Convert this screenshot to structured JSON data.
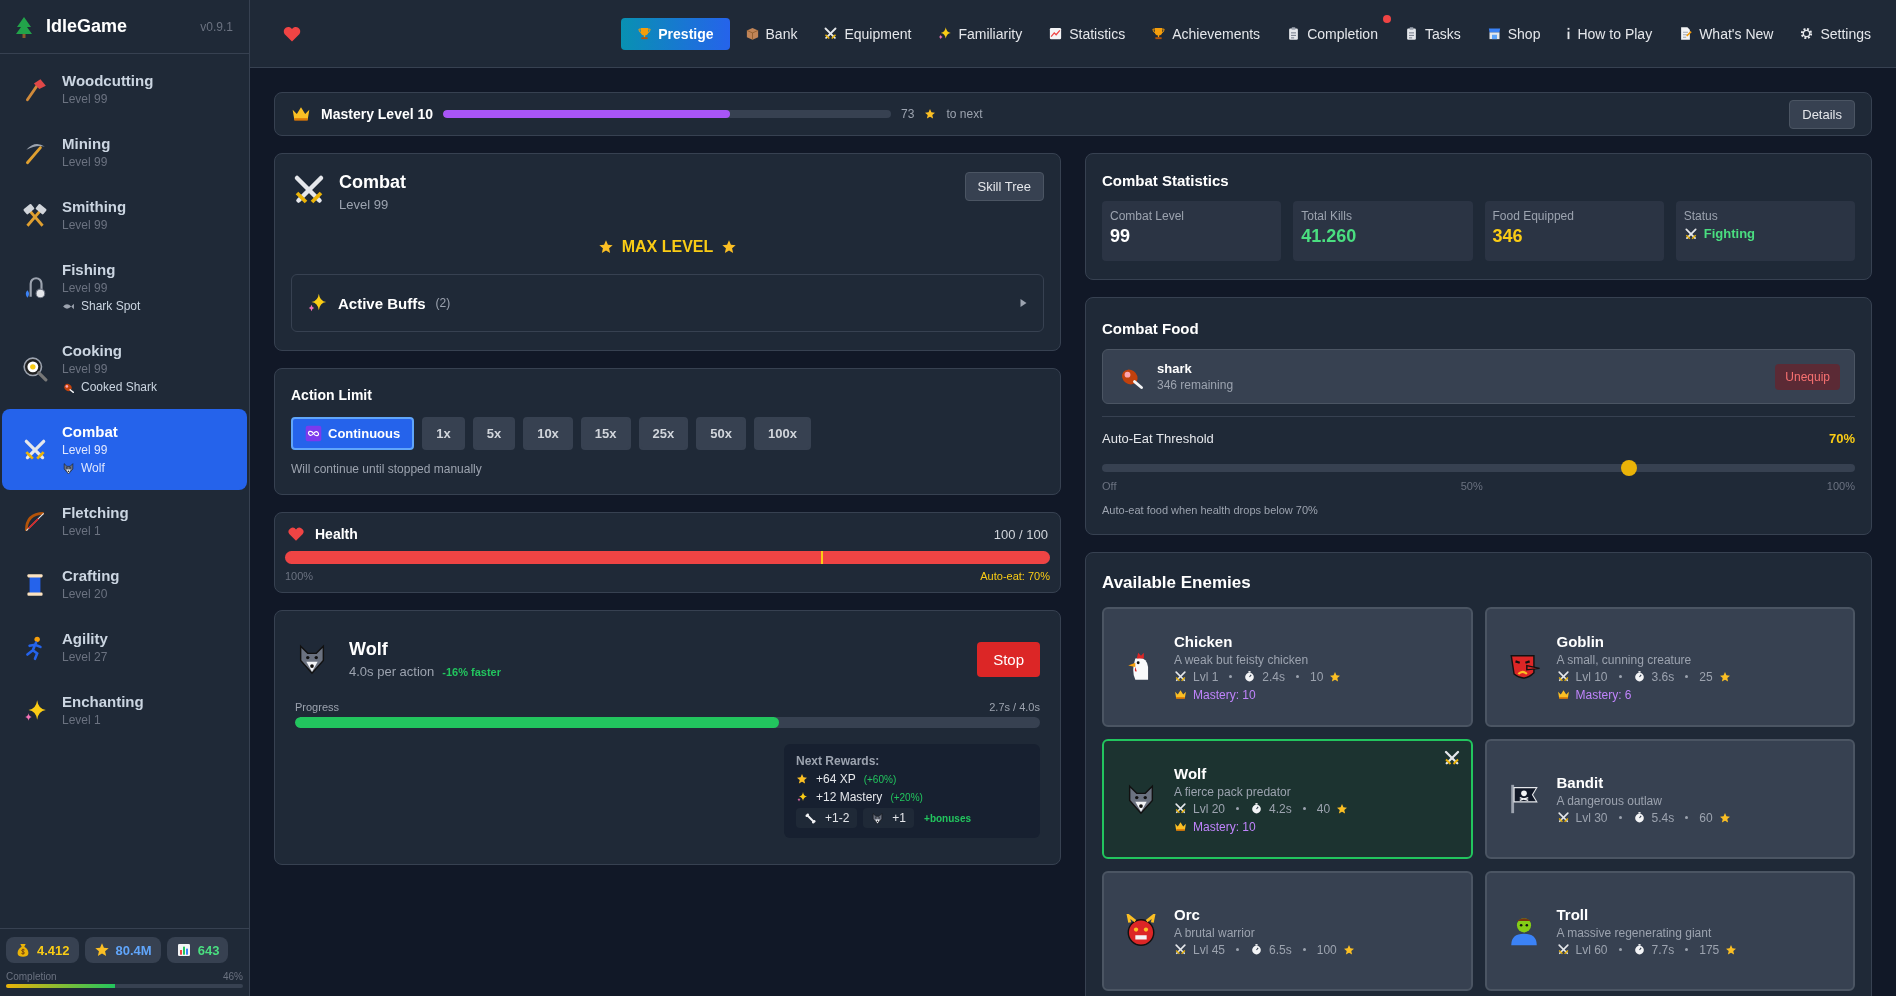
{
  "sidebar": {
    "brand": "IdleGame",
    "version": "v0.9.1",
    "items": [
      {
        "name": "Woodcutting",
        "level": "Level 99",
        "selected": false
      },
      {
        "name": "Mining",
        "level": "Level 99",
        "selected": false
      },
      {
        "name": "Smithing",
        "level": "Level 99",
        "selected": false
      },
      {
        "name": "Fishing",
        "level": "Level 99",
        "activity": "Shark Spot",
        "selected": false
      },
      {
        "name": "Cooking",
        "level": "Level 99",
        "activity": "Cooked Shark",
        "selected": false
      },
      {
        "name": "Combat",
        "level": "Level 99",
        "activity": "Wolf",
        "selected": true
      },
      {
        "name": "Fletching",
        "level": "Level 1",
        "selected": false
      },
      {
        "name": "Crafting",
        "level": "Level 20",
        "selected": false
      },
      {
        "name": "Agility",
        "level": "Level 27",
        "selected": false
      },
      {
        "name": "Enchanting",
        "level": "Level 1",
        "selected": false
      }
    ],
    "currencies": [
      {
        "kind": "gold",
        "value": "4.412"
      },
      {
        "kind": "xp",
        "value": "80.4M"
      },
      {
        "kind": "stats",
        "value": "643"
      }
    ],
    "completion": {
      "label": "Completion",
      "percent": "46%",
      "level": 0.46
    }
  },
  "nav": [
    {
      "label": "Prestige",
      "selected": true,
      "notification": false
    },
    {
      "label": "Bank",
      "selected": false,
      "notification": false
    },
    {
      "label": "Equipment",
      "selected": false,
      "notification": false
    },
    {
      "label": "Familiarity",
      "selected": false,
      "notification": false
    },
    {
      "label": "Statistics",
      "selected": false,
      "notification": false
    },
    {
      "label": "Achievements",
      "selected": false,
      "notification": false
    },
    {
      "label": "Completion",
      "selected": false,
      "notification": true
    },
    {
      "label": "Tasks",
      "selected": false,
      "notification": false
    },
    {
      "label": "Shop",
      "selected": false,
      "notification": false
    },
    {
      "label": "How to Play",
      "selected": false,
      "notification": false
    },
    {
      "label": "What's New",
      "selected": false,
      "notification": false
    },
    {
      "label": "Settings",
      "selected": false,
      "notification": false
    }
  ],
  "mastery": {
    "label": "Mastery Level 10",
    "level": 0.64,
    "amount": "73",
    "suffix": "to next",
    "button": "Details"
  },
  "skill": {
    "name": "Combat",
    "level": "Level 99",
    "button": "Skill Tree",
    "max_label": "MAX LEVEL",
    "buffs": {
      "label": "Active Buffs",
      "count": "(2)"
    }
  },
  "action_limit": {
    "title": "Action Limit",
    "options": [
      {
        "label": "Continuous",
        "selected": true
      },
      {
        "label": "1x",
        "selected": false
      },
      {
        "label": "5x",
        "selected": false
      },
      {
        "label": "10x",
        "selected": false
      },
      {
        "label": "15x",
        "selected": false
      },
      {
        "label": "25x",
        "selected": false
      },
      {
        "label": "50x",
        "selected": false
      },
      {
        "label": "100x",
        "selected": false
      }
    ],
    "hint": "Will continue until stopped manually"
  },
  "health": {
    "label": "Health",
    "value": "100 / 100",
    "level": 1.0,
    "min_label": "100%",
    "auto_eat": "Auto-eat: 70%"
  },
  "action": {
    "name": "Wolf",
    "rate": "4.0s per action",
    "bonus": "-16% faster",
    "button": "Stop",
    "progress_label": "Progress",
    "progress_value": "2.7s / 4.0s",
    "level": 0.65,
    "rewards": {
      "title": "Next Rewards:",
      "lines": [
        {
          "text": "+64 XP",
          "bonus": "(+60%)"
        },
        {
          "text": "+12 Mastery",
          "bonus": "(+20%)"
        }
      ],
      "drops": [
        {
          "text": "+1-2"
        },
        {
          "text": "+1"
        }
      ],
      "extra": "+bonuses"
    }
  },
  "stats": {
    "title": "Combat Statistics",
    "cards": [
      {
        "label": "Combat Level",
        "value": "99",
        "kind": "plain"
      },
      {
        "label": "Total Kills",
        "value": "41.260",
        "kind": "kills"
      },
      {
        "label": "Food Equipped",
        "value": "346",
        "kind": "food"
      },
      {
        "label": "Status",
        "value": "Fighting",
        "kind": "status"
      }
    ]
  },
  "food": {
    "title": "Combat Food",
    "item": {
      "name": "shark",
      "remaining": "346 remaining",
      "button": "Unequip"
    },
    "threshold": {
      "label": "Auto-Eat Threshold",
      "value": "70%",
      "level": 0.7,
      "ticks": [
        "Off",
        "50%",
        "100%"
      ],
      "hint": "Auto-eat food when health drops below 70%"
    }
  },
  "enemies": {
    "title": "Available Enemies",
    "items": [
      {
        "name": "Chicken",
        "description": "A weak but feisty chicken",
        "level": "Lvl 1",
        "time": "2.4s",
        "reward": "10",
        "mastery": "Mastery: 10",
        "selected": false
      },
      {
        "name": "Goblin",
        "description": "A small, cunning creature",
        "level": "Lvl 10",
        "time": "3.6s",
        "reward": "25",
        "mastery": "Mastery: 6",
        "selected": false
      },
      {
        "name": "Wolf",
        "description": "A fierce pack predator",
        "level": "Lvl 20",
        "time": "4.2s",
        "reward": "40",
        "mastery": "Mastery: 10",
        "selected": true
      },
      {
        "name": "Bandit",
        "description": "A dangerous outlaw",
        "level": "Lvl 30",
        "time": "5.4s",
        "reward": "60",
        "selected": false
      },
      {
        "name": "Orc",
        "description": "A brutal warrior",
        "level": "Lvl 45",
        "time": "6.5s",
        "reward": "100",
        "selected": false
      },
      {
        "name": "Troll",
        "description": "A massive regenerating giant",
        "level": "Lvl 60",
        "time": "7.7s",
        "reward": "175",
        "selected": false
      }
    ]
  }
}
